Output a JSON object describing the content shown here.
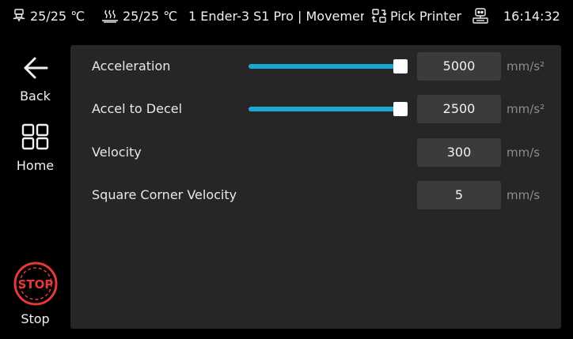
{
  "status_bar": {
    "extruder_temp": "25/25 ℃",
    "bed_temp": "25/25 ℃",
    "title": "1 Ender-3 S1 Pro | Movemen",
    "pick_printer": "Pick Printer",
    "time": "16:14:32",
    "icons": [
      "extruder-icon",
      "bed-icon",
      "pick-printer-icon",
      "network-icon"
    ]
  },
  "sidebar": {
    "back_label": "Back",
    "home_label": "Home",
    "stop_label": "Stop",
    "stop_icon_text": "STOP",
    "stop_color": "#e53935"
  },
  "settings": {
    "rows": [
      {
        "label": "Acceleration",
        "value": "5000",
        "unit": "mm/s²",
        "slider_fraction": 0.96
      },
      {
        "label": "Accel to Decel",
        "value": "2500",
        "unit": "mm/s²",
        "slider_fraction": 0.96
      },
      {
        "label": "Velocity",
        "value": "300",
        "unit": "mm/s"
      },
      {
        "label": "Square Corner Velocity",
        "value": "5",
        "unit": "mm/s"
      }
    ]
  },
  "colors": {
    "accent": "#1aa6d6",
    "panel": "#262626",
    "field": "#3b3b3b"
  }
}
